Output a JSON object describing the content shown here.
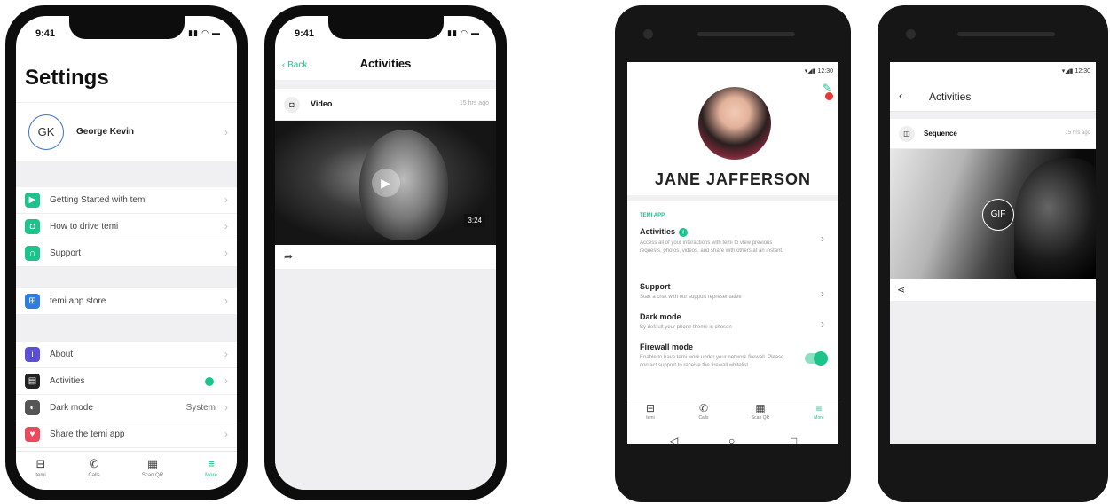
{
  "colors": {
    "accent": "#1ec38c",
    "alert": "#e53935",
    "profile_ring": "#3b6fd8"
  },
  "ios_settings": {
    "status_time": "9:41",
    "title": "Settings",
    "profile": {
      "initials": "GK",
      "name": "George Kevin"
    },
    "group1": [
      {
        "label": "Getting Started with temi",
        "icon": "play-icon",
        "color": "#1ec38c"
      },
      {
        "label": "How to drive temi",
        "icon": "video-camera-icon",
        "color": "#1ec38c"
      },
      {
        "label": "Support",
        "icon": "headset-icon",
        "color": "#1ec38c"
      }
    ],
    "group2": [
      {
        "label": "temi app store",
        "icon": "app-store-icon",
        "color": "#2f7de1"
      }
    ],
    "group3": [
      {
        "label": "About",
        "icon": "info-icon",
        "color": "#5b4fd6",
        "value": ""
      },
      {
        "label": "Activities",
        "icon": "activities-icon",
        "color": "#222222",
        "value": ""
      },
      {
        "label": "Dark mode",
        "icon": "dark-mode-icon",
        "color": "#555555",
        "value": "System"
      },
      {
        "label": "Share the temi app",
        "icon": "heart-icon",
        "color": "#e94a5d",
        "value": ""
      }
    ],
    "tabs": [
      {
        "label": "temi",
        "icon": "temi-icon"
      },
      {
        "label": "Calls",
        "icon": "phone-icon"
      },
      {
        "label": "Scan QR",
        "icon": "qr-icon"
      },
      {
        "label": "More",
        "icon": "menu-icon"
      }
    ]
  },
  "ios_activities": {
    "status_time": "9:41",
    "back_label": "Back",
    "title": "Activities",
    "item": {
      "title": "Video",
      "time": "15 hrs ago",
      "duration": "3:24"
    }
  },
  "android_profile": {
    "status_time": "12:30",
    "name": "JANE JAFFERSON",
    "section_label": "TEMI APP",
    "items": [
      {
        "title": "Activities",
        "desc": "Access all of your interactions with temi to view previous requests, photos, videos, and share with others at an instant."
      },
      {
        "title": "Support",
        "desc": "Start a chat with our support representative"
      },
      {
        "title": "Dark mode",
        "desc": "By default your phone theme is chosen"
      },
      {
        "title": "Firewall mode",
        "desc": "Enable to have temi work under your network firewall. Please contact support to receive the firewall whitelist."
      }
    ],
    "tabs": [
      {
        "label": "temi"
      },
      {
        "label": "Calls"
      },
      {
        "label": "Scan QR"
      },
      {
        "label": "More"
      }
    ]
  },
  "android_activities": {
    "status_time": "12:30",
    "title": "Activities",
    "item": {
      "title": "Sequence",
      "time": "15 hrs ago"
    },
    "media_badge": "GIF"
  }
}
